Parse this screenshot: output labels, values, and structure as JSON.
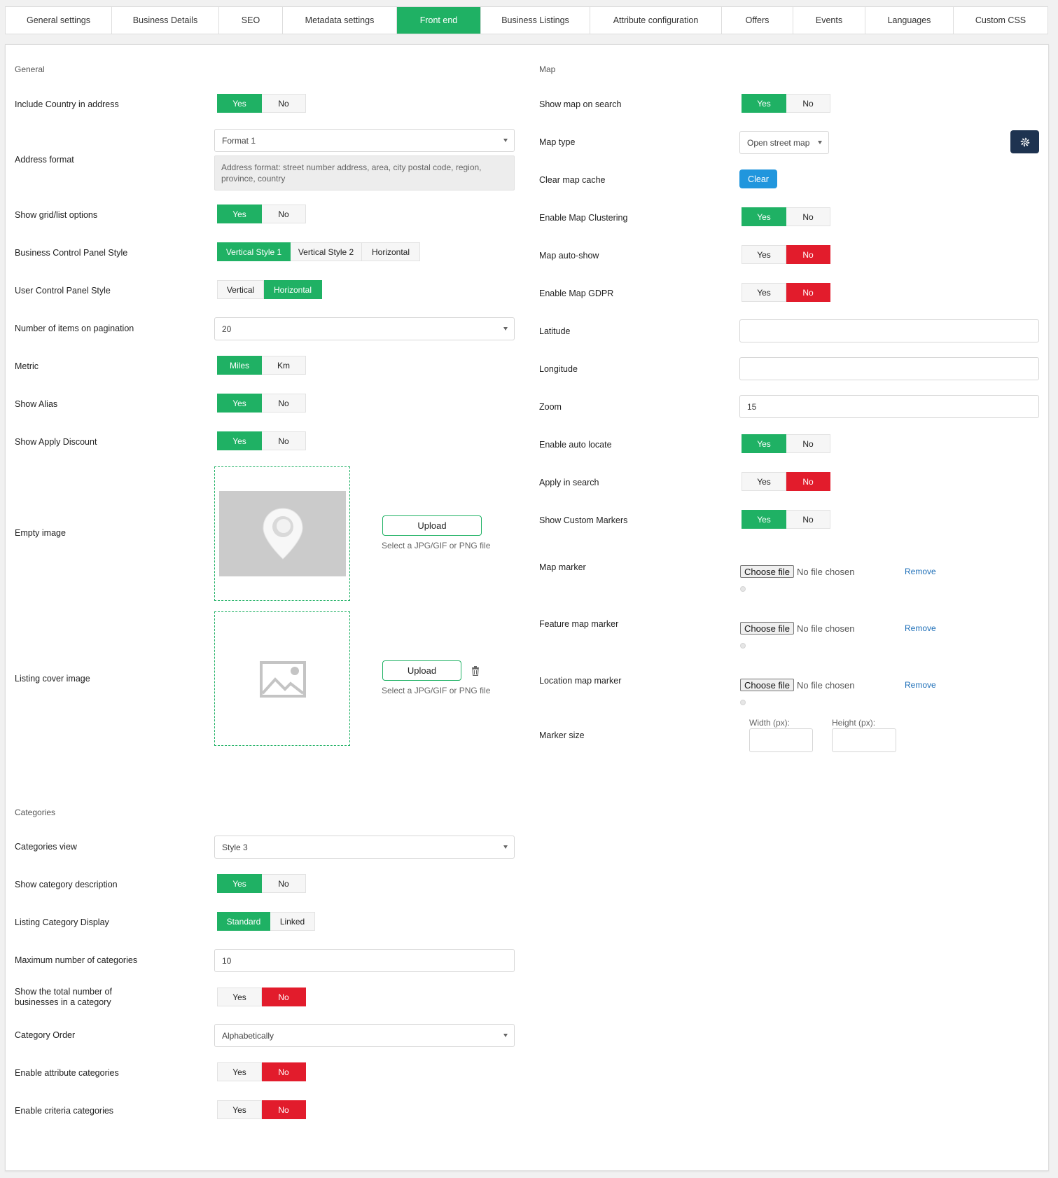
{
  "tabs": [
    {
      "label": "General settings",
      "active": false
    },
    {
      "label": "Business Details",
      "active": false
    },
    {
      "label": "SEO",
      "active": false
    },
    {
      "label": "Metadata settings",
      "active": false
    },
    {
      "label": "Front end",
      "active": true
    },
    {
      "label": "Business Listings",
      "active": false
    },
    {
      "label": "Attribute configuration",
      "active": false
    },
    {
      "label": "Offers",
      "active": false
    },
    {
      "label": "Events",
      "active": false
    },
    {
      "label": "Languages",
      "active": false
    },
    {
      "label": "Custom CSS",
      "active": false
    }
  ],
  "colors": {
    "accent": "#1fb164",
    "danger": "#e21c2c",
    "info": "#2196dd",
    "dark": "#1e3350"
  },
  "general": {
    "title": "General",
    "include_country": {
      "label": "Include Country in address",
      "options": [
        "Yes",
        "No"
      ],
      "selected": "Yes"
    },
    "address_format": {
      "label": "Address format",
      "value": "Format 1",
      "note": "Address format: street number address, area, city postal code, region, province, country"
    },
    "show_grid": {
      "label": "Show grid/list options",
      "options": [
        "Yes",
        "No"
      ],
      "selected": "Yes"
    },
    "business_cp_style": {
      "label": "Business Control Panel Style",
      "options": [
        "Vertical Style 1",
        "Vertical Style 2",
        "Horizontal"
      ],
      "selected": "Vertical Style 1"
    },
    "user_cp_style": {
      "label": "User Control Panel Style",
      "options": [
        "Vertical",
        "Horizontal"
      ],
      "selected": "Horizontal"
    },
    "pagination": {
      "label": "Number of items on pagination",
      "value": "20"
    },
    "metric": {
      "label": "Metric",
      "options": [
        "Miles",
        "Km"
      ],
      "selected": "Miles"
    },
    "show_alias": {
      "label": "Show Alias",
      "options": [
        "Yes",
        "No"
      ],
      "selected": "Yes"
    },
    "show_apply_discount": {
      "label": "Show Apply Discount",
      "options": [
        "Yes",
        "No"
      ],
      "selected": "Yes"
    },
    "empty_image": {
      "label": "Empty image",
      "upload_label": "Upload",
      "hint": "Select a JPG/GIF or PNG file",
      "icon": "map-pin-icon"
    },
    "cover_image": {
      "label": "Listing cover image",
      "upload_label": "Upload",
      "hint": "Select a JPG/GIF or PNG file",
      "icon": "image-placeholder-icon"
    }
  },
  "map": {
    "title": "Map",
    "show_map_on_search": {
      "label": "Show map on search",
      "options": [
        "Yes",
        "No"
      ],
      "selected": "Yes"
    },
    "map_type": {
      "label": "Map type",
      "value": "Open street map"
    },
    "clear_cache": {
      "label": "Clear map cache",
      "button": "Clear"
    },
    "clustering": {
      "label": "Enable Map Clustering",
      "options": [
        "Yes",
        "No"
      ],
      "selected": "Yes"
    },
    "auto_show": {
      "label": "Map auto-show",
      "options": [
        "Yes",
        "No"
      ],
      "selected": "No"
    },
    "gdpr": {
      "label": "Enable Map GDPR",
      "options": [
        "Yes",
        "No"
      ],
      "selected": "No"
    },
    "latitude": {
      "label": "Latitude",
      "value": ""
    },
    "longitude": {
      "label": "Longitude",
      "value": ""
    },
    "zoom": {
      "label": "Zoom",
      "value": "15"
    },
    "auto_locate": {
      "label": "Enable auto locate",
      "options": [
        "Yes",
        "No"
      ],
      "selected": "Yes"
    },
    "apply_in_search": {
      "label": "Apply in search",
      "options": [
        "Yes",
        "No"
      ],
      "selected": "No"
    },
    "custom_markers": {
      "label": "Show Custom Markers",
      "options": [
        "Yes",
        "No"
      ],
      "selected": "Yes"
    },
    "map_marker": {
      "label": "Map marker",
      "choose": "Choose file",
      "status": "No file chosen",
      "remove": "Remove"
    },
    "feature_marker": {
      "label": "Feature map marker",
      "choose": "Choose file",
      "status": "No file chosen",
      "remove": "Remove"
    },
    "location_marker": {
      "label": "Location map marker",
      "choose": "Choose file",
      "status": "No file chosen",
      "remove": "Remove"
    },
    "marker_size": {
      "label": "Marker size",
      "width_label": "Width (px):",
      "height_label": "Height (px):",
      "width": "",
      "height": ""
    }
  },
  "categories": {
    "title": "Categories",
    "view": {
      "label": "Categories view",
      "value": "Style 3"
    },
    "show_description": {
      "label": "Show category description",
      "options": [
        "Yes",
        "No"
      ],
      "selected": "Yes"
    },
    "listing_display": {
      "label": "Listing Category Display",
      "options": [
        "Standard",
        "Linked"
      ],
      "selected": "Standard"
    },
    "max_categories": {
      "label": "Maximum number of categories",
      "value": "10"
    },
    "show_total": {
      "label_line1": "Show the total number of",
      "label_line2": "businesses in a category",
      "options": [
        "Yes",
        "No"
      ],
      "selected": "No"
    },
    "order": {
      "label": "Category Order",
      "value": "Alphabetically"
    },
    "attribute_categories": {
      "label": "Enable attribute categories",
      "options": [
        "Yes",
        "No"
      ],
      "selected": "No"
    },
    "criteria_categories": {
      "label": "Enable criteria categories",
      "options": [
        "Yes",
        "No"
      ],
      "selected": "No"
    }
  }
}
